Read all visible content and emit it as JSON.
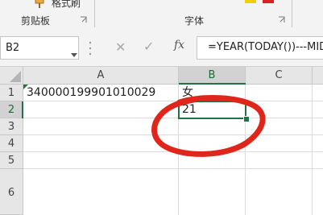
{
  "ribbon": {
    "format_painter_label": "格式刷",
    "clipboard_group_label": "剪贴板",
    "font_group_label": "字体"
  },
  "formula_bar": {
    "name_box_value": "B2",
    "cancel_glyph": "✕",
    "enter_glyph": "✓",
    "function_glyph": "fx",
    "formula_text": "=YEAR(TODAY())---MID("
  },
  "sheet": {
    "columns": [
      "A",
      "B",
      "C"
    ],
    "rows": [
      "1",
      "2",
      "3",
      "4",
      "5",
      "6"
    ],
    "cells": {
      "A1": "340000199901010029",
      "B1": "女",
      "B2": "21"
    },
    "active_cell": "B2"
  },
  "colors": {
    "accent_green": "#217346",
    "annotation_red": "#e0261b"
  }
}
